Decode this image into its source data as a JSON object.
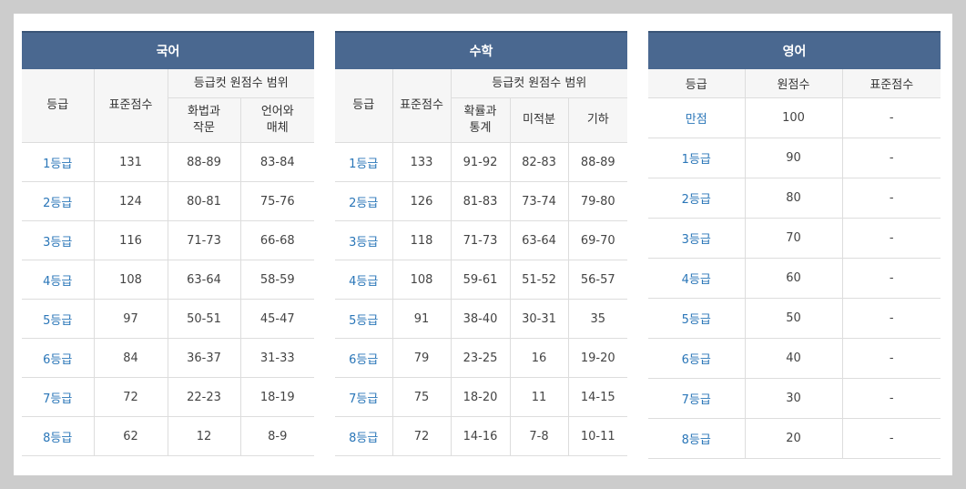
{
  "korean": {
    "title": "국어",
    "col_grade": "등급",
    "col_standard": "표준점수",
    "col_cutoff": "등급컷 원점수 범위",
    "sub1": "화법과\n작문",
    "sub2": "언어와\n매체",
    "rows": [
      {
        "grade": "1등급",
        "std": "131",
        "a": "88-89",
        "b": "83-84"
      },
      {
        "grade": "2등급",
        "std": "124",
        "a": "80-81",
        "b": "75-76"
      },
      {
        "grade": "3등급",
        "std": "116",
        "a": "71-73",
        "b": "66-68"
      },
      {
        "grade": "4등급",
        "std": "108",
        "a": "63-64",
        "b": "58-59"
      },
      {
        "grade": "5등급",
        "std": "97",
        "a": "50-51",
        "b": "45-47"
      },
      {
        "grade": "6등급",
        "std": "84",
        "a": "36-37",
        "b": "31-33"
      },
      {
        "grade": "7등급",
        "std": "72",
        "a": "22-23",
        "b": "18-19"
      },
      {
        "grade": "8등급",
        "std": "62",
        "a": "12",
        "b": "8-9"
      }
    ]
  },
  "math": {
    "title": "수학",
    "col_grade": "등급",
    "col_standard": "표준점수",
    "col_cutoff": "등급컷 원점수 범위",
    "sub1": "확률과\n통계",
    "sub2": "미적분",
    "sub3": "기하",
    "rows": [
      {
        "grade": "1등급",
        "std": "133",
        "a": "91-92",
        "b": "82-83",
        "c": "88-89"
      },
      {
        "grade": "2등급",
        "std": "126",
        "a": "81-83",
        "b": "73-74",
        "c": "79-80"
      },
      {
        "grade": "3등급",
        "std": "118",
        "a": "71-73",
        "b": "63-64",
        "c": "69-70"
      },
      {
        "grade": "4등급",
        "std": "108",
        "a": "59-61",
        "b": "51-52",
        "c": "56-57"
      },
      {
        "grade": "5등급",
        "std": "91",
        "a": "38-40",
        "b": "30-31",
        "c": "35"
      },
      {
        "grade": "6등급",
        "std": "79",
        "a": "23-25",
        "b": "16",
        "c": "19-20"
      },
      {
        "grade": "7등급",
        "std": "75",
        "a": "18-20",
        "b": "11",
        "c": "14-15"
      },
      {
        "grade": "8등급",
        "std": "72",
        "a": "14-16",
        "b": "7-8",
        "c": "10-11"
      }
    ]
  },
  "english": {
    "title": "영어",
    "col_grade": "등급",
    "col_raw": "원점수",
    "col_standard": "표준점수",
    "rows": [
      {
        "grade": "만점",
        "raw": "100",
        "std": "-"
      },
      {
        "grade": "1등급",
        "raw": "90",
        "std": "-"
      },
      {
        "grade": "2등급",
        "raw": "80",
        "std": "-"
      },
      {
        "grade": "3등급",
        "raw": "70",
        "std": "-"
      },
      {
        "grade": "4등급",
        "raw": "60",
        "std": "-"
      },
      {
        "grade": "5등급",
        "raw": "50",
        "std": "-"
      },
      {
        "grade": "6등급",
        "raw": "40",
        "std": "-"
      },
      {
        "grade": "7등급",
        "raw": "30",
        "std": "-"
      },
      {
        "grade": "8등급",
        "raw": "20",
        "std": "-"
      }
    ]
  }
}
